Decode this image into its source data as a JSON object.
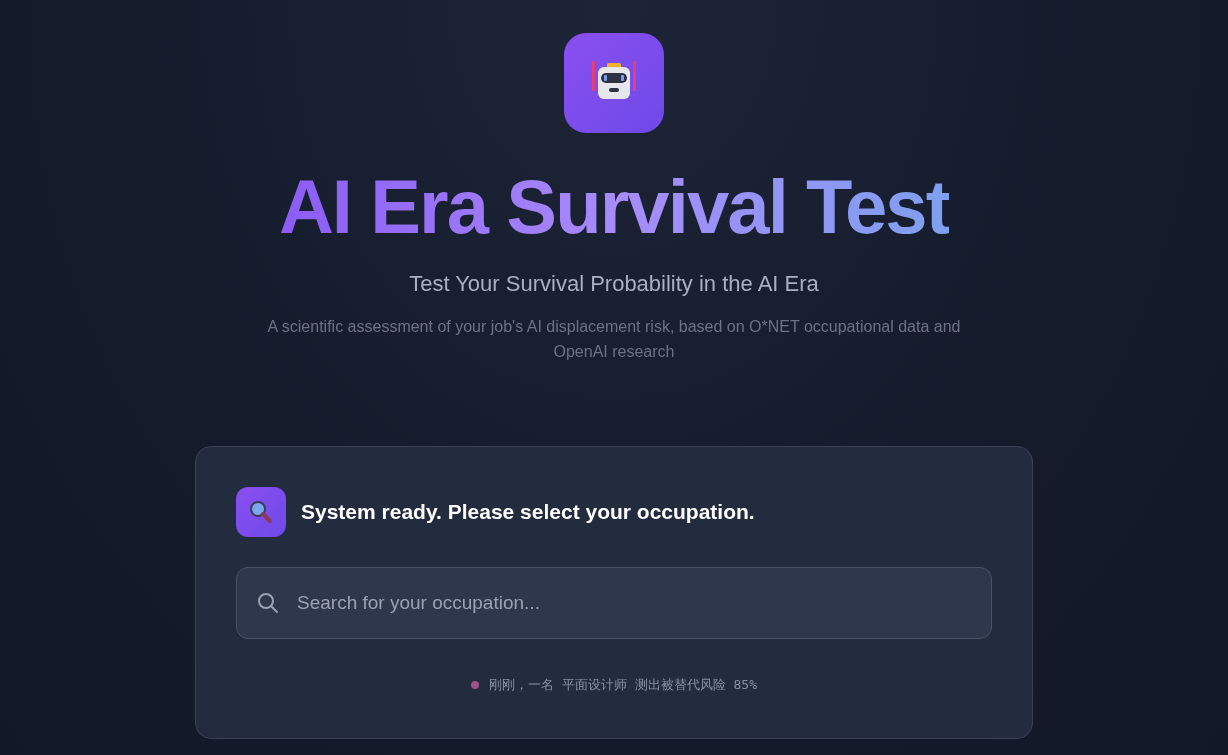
{
  "header": {
    "title": "AI Era Survival Test",
    "subtitle": "Test Your Survival Probability in the AI Era",
    "description": "A scientific assessment of your job's AI displacement risk, based on O*NET occupational data and OpenAI research"
  },
  "card": {
    "status": "System ready. Please select your occupation.",
    "search": {
      "placeholder": "Search for your occupation..."
    },
    "activity": {
      "text": "刚刚，一名 平面设计师 测出被替代风险 85%",
      "color": "#a0508a"
    }
  }
}
